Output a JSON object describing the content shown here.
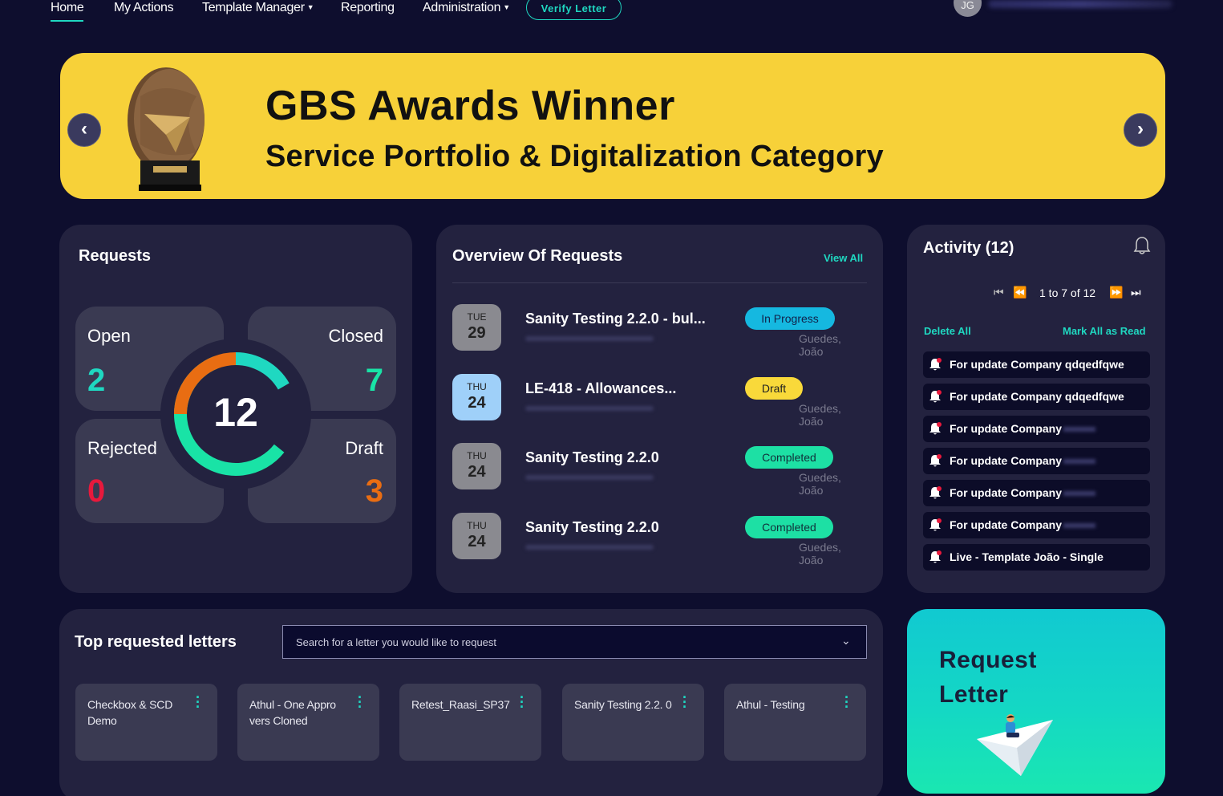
{
  "nav": {
    "items": [
      {
        "label": "Home"
      },
      {
        "label": "My Actions"
      },
      {
        "label": "Template Manager"
      },
      {
        "label": "Reporting"
      },
      {
        "label": "Administration"
      }
    ],
    "verify_label": "Verify Letter",
    "avatar_initials": "JG"
  },
  "banner": {
    "title": "GBS Awards Winner",
    "subtitle": "Service Portfolio & Digitalization Category",
    "color": "#f7d139"
  },
  "requests": {
    "title": "Requests",
    "total": "12",
    "quadrants": [
      {
        "label": "Open",
        "value": "2",
        "color": "#1fd8c1"
      },
      {
        "label": "Closed",
        "value": "7",
        "color": "#19e3a6"
      },
      {
        "label": "Rejected",
        "value": "0",
        "color": "#e8193c"
      },
      {
        "label": "Draft",
        "value": "3",
        "color": "#e96d12"
      }
    ]
  },
  "overview": {
    "title": "Overview Of Requests",
    "view_all": "View All",
    "rows": [
      {
        "dow": "TUE",
        "day": "29",
        "name": "Sanity Testing 2.2.0 - bul...",
        "status": "In Progress",
        "person": "Guedes, João"
      },
      {
        "dow": "THU",
        "day": "24",
        "name": "LE-418 - Allowances...",
        "status": "Draft",
        "person": "Guedes, João"
      },
      {
        "dow": "THU",
        "day": "24",
        "name": "Sanity Testing 2.2.0",
        "status": "Completed",
        "person": "Guedes, João"
      },
      {
        "dow": "THU",
        "day": "24",
        "name": "Sanity Testing 2.2.0",
        "status": "Completed",
        "person": "Guedes, João"
      }
    ]
  },
  "activity": {
    "title": "Activity (12)",
    "pager_text": "1 to 7 of 12",
    "delete_all": "Delete All",
    "mark_all": "Mark All as Read",
    "notifications": [
      {
        "text": "For update Company qdqedfqwe"
      },
      {
        "text": "For update Company qdqedfqwe"
      },
      {
        "text": "For update Company"
      },
      {
        "text": "For update Company"
      },
      {
        "text": "For update Company"
      },
      {
        "text": "For update Company"
      },
      {
        "text": "Live - Template João - Single"
      }
    ]
  },
  "top_letters": {
    "title": "Top requested letters",
    "search_placeholder": "Search for a letter you would like to request",
    "tiles": [
      {
        "label": "Checkbox & SCD Demo"
      },
      {
        "label": "Athul - One Appro vers Cloned"
      },
      {
        "label": "Retest_Raasi_SP37"
      },
      {
        "label": "Sanity Testing 2.2. 0"
      },
      {
        "label": "Athul - Testing"
      }
    ]
  },
  "request_letter": {
    "line1": "Request",
    "line2": "Letter"
  }
}
